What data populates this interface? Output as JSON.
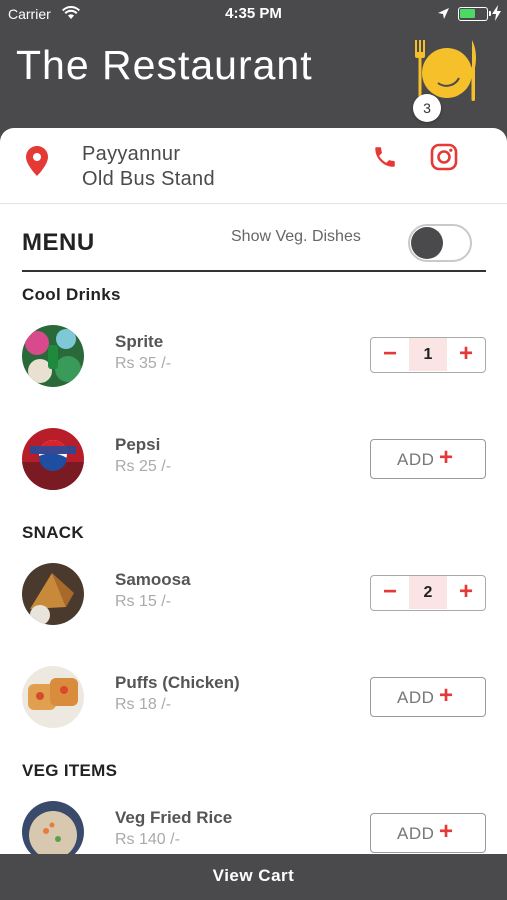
{
  "status_bar": {
    "carrier": "Carrier",
    "time": "4:35 PM"
  },
  "header": {
    "title": "The Restaurant",
    "cart_count": "3",
    "plate_color": "#f5c02a"
  },
  "location": {
    "line1": "Payyannur",
    "line2": "Old Bus Stand",
    "accent_color": "#e53935"
  },
  "menu": {
    "title": "MENU",
    "veg_toggle_label": "Show Veg. Dishes",
    "veg_toggle_on": false
  },
  "sections": [
    {
      "title": "Cool Drinks",
      "items": [
        {
          "name": "Sprite",
          "price": "Rs 35 /-",
          "quantity": "1",
          "minus": "−",
          "plus": "+"
        },
        {
          "name": "Pepsi",
          "price": "Rs 25 /-",
          "add_label": "ADD",
          "plus": "+"
        }
      ]
    },
    {
      "title": "SNACK",
      "items": [
        {
          "name": "Samoosa",
          "price": "Rs 15 /-",
          "quantity": "2",
          "minus": "−",
          "plus": "+"
        },
        {
          "name": "Puffs (Chicken)",
          "price": "Rs 18 /-",
          "add_label": "ADD",
          "plus": "+"
        }
      ]
    },
    {
      "title": "VEG ITEMS",
      "items": [
        {
          "name": "Veg Fried Rice",
          "price": "Rs 140 /-",
          "add_label": "ADD",
          "plus": "+"
        }
      ]
    }
  ],
  "footer": {
    "view_cart_label": "View Cart"
  }
}
